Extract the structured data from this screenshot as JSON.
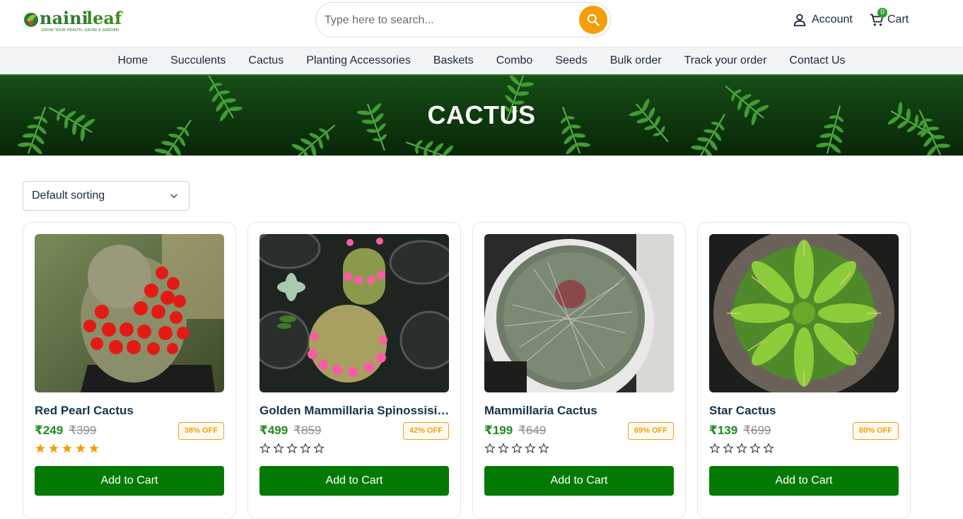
{
  "brand": {
    "name": "naini leaf",
    "tagline": "GROW YOUR HEALTH, GROW A GARDEN",
    "color": "#2d7a2d"
  },
  "search": {
    "placeholder": "Type here to search...",
    "button_color": "#f59e0b",
    "icon": "search-icon"
  },
  "header": {
    "account_label": "Account",
    "cart_label": "Cart",
    "cart_count": "0"
  },
  "nav": {
    "items": [
      {
        "label": "Home"
      },
      {
        "label": "Succulents"
      },
      {
        "label": "Cactus"
      },
      {
        "label": "Planting Accessories"
      },
      {
        "label": "Baskets"
      },
      {
        "label": "Combo"
      },
      {
        "label": "Seeds"
      },
      {
        "label": "Bulk order"
      },
      {
        "label": "Track your order"
      },
      {
        "label": "Contact Us"
      }
    ]
  },
  "banner": {
    "title": "CACTUS"
  },
  "sort": {
    "selected": "Default sorting"
  },
  "products": [
    {
      "name": "Red Pearl Cactus",
      "price": "₹249",
      "old_price": "₹399",
      "discount": "38% OFF",
      "rating": 5,
      "button": "Add to Cart"
    },
    {
      "name": "Golden Mammillaria Spinossisima",
      "price": "₹499",
      "old_price": "₹859",
      "discount": "42% OFF",
      "rating": 0,
      "button": "Add to Cart"
    },
    {
      "name": "Mammillaria Cactus",
      "price": "₹199",
      "old_price": "₹649",
      "discount": "69% OFF",
      "rating": 0,
      "button": "Add to Cart"
    },
    {
      "name": "Star Cactus",
      "price": "₹139",
      "old_price": "₹699",
      "discount": "80% OFF",
      "rating": 0,
      "button": "Add to Cart"
    }
  ],
  "colors": {
    "accent_green": "#047a04",
    "price_green": "#1f8a1f",
    "discount_orange": "#f59e0b",
    "star_gold": "#f59e0b"
  }
}
